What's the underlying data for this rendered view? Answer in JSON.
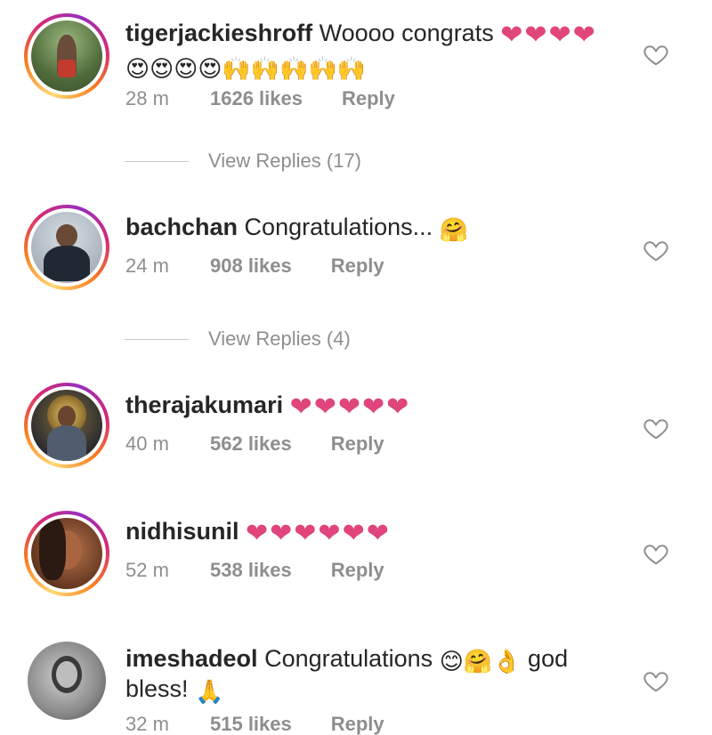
{
  "comments": [
    {
      "username": "tigerjackieshroff",
      "text": " Woooo congrats ",
      "hearts": "❤❤❤❤",
      "emojis": "😍😍😍😍🙌🙌🙌🙌🙌",
      "time": "28 m",
      "likes": "1626 likes",
      "reply": "Reply",
      "view_replies": "View Replies (17)"
    },
    {
      "username": "bachchan",
      "text": " Congratulations... ",
      "emojis": "🤗",
      "time": "24 m",
      "likes": "908 likes",
      "reply": "Reply",
      "view_replies": "View Replies (4)"
    },
    {
      "username": "therajakumari",
      "text": " ",
      "hearts": "❤❤❤❤❤",
      "time": "40 m",
      "likes": "562 likes",
      "reply": "Reply"
    },
    {
      "username": "nidhisunil",
      "text": " ",
      "hearts": "❤❤❤❤❤❤",
      "time": "52 m",
      "likes": "538 likes",
      "reply": "Reply"
    },
    {
      "username": "imeshadeol",
      "text": " Congratulations ",
      "emojis": "😊🤗👌",
      "text_after": " god bless! ",
      "emojis_after": "🙏",
      "time": "32 m",
      "likes": "515 likes",
      "reply": "Reply"
    }
  ],
  "colors": {
    "heart": "#e0457b",
    "meta": "#8e8e8e",
    "text": "#262626"
  }
}
